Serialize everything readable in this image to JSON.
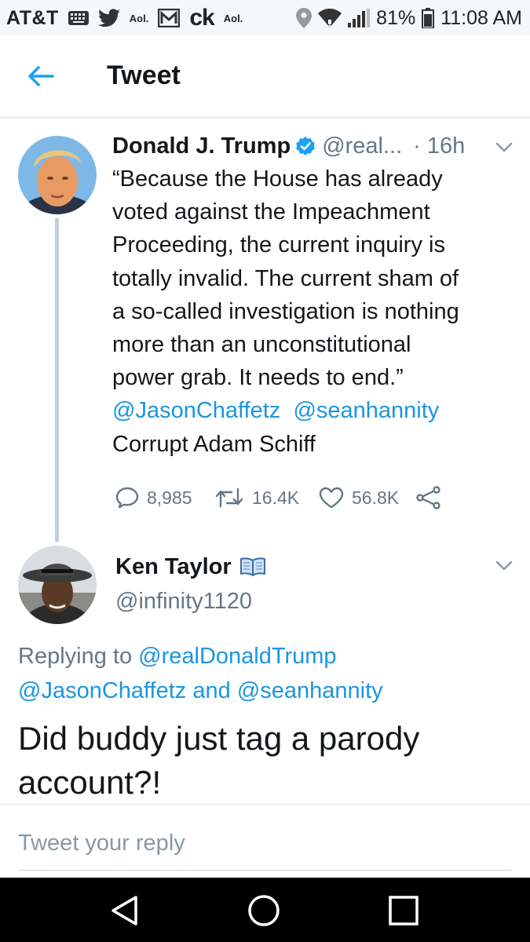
{
  "status_bar": {
    "carrier": "AT&T",
    "aol_label": "Aol.",
    "ck_label": "ck",
    "aol_label_2": "Aol.",
    "battery": "81%",
    "time": "11:08 AM"
  },
  "header": {
    "title": "Tweet"
  },
  "original_tweet": {
    "display_name": "Donald J. Trump",
    "handle": "@real...",
    "time": "· 16h",
    "text_lines": [
      "“Because the House has already",
      "voted against the Impeachment",
      "Proceeding, the current inquiry is",
      "totally invalid. The current sham of",
      "a so-called investigation is nothing",
      "more than an unconstitutional",
      "power grab. It needs to end.”"
    ],
    "mention_1": "@JasonChaffetz",
    "mention_2": "@seanhannity",
    "text_last": "Corrupt Adam Schiff",
    "replies": "8,985",
    "retweets": "16.4K",
    "likes": "56.8K"
  },
  "reply_tweet": {
    "display_name": "Ken Taylor",
    "handle": "@infinity1120",
    "replying_prefix": "Replying to",
    "replying_to_1": "@realDonaldTrump",
    "replying_to_2": "@JasonChaffetz",
    "replying_and": "and",
    "replying_to_3": "@seanhannity",
    "text_lines": [
      "Did buddy just tag a parody",
      "account?!"
    ]
  },
  "reply_box": {
    "placeholder": "Tweet your reply"
  },
  "colors": {
    "link_blue": "#1b95e0",
    "twitter_blue": "#1da1f2",
    "secondary_gray": "#657786"
  },
  "icons": {
    "back": "arrow-left-icon",
    "verified": "verified-badge-icon",
    "caret": "chevron-down-icon",
    "reply": "reply-icon",
    "retweet": "retweet-icon",
    "like": "heart-icon",
    "share": "share-icon",
    "book": "open-book-icon"
  }
}
